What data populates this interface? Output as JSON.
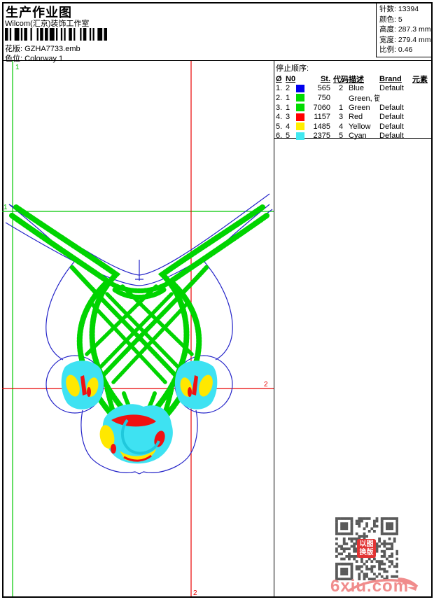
{
  "header": {
    "title": "生产作业图",
    "studio": "Wilcom(汇京)装饰工作室",
    "pattern_label": "花版:",
    "pattern_value": "GZHA7733.emb",
    "colorway_label": "色位:",
    "colorway_value": "Colorway 1"
  },
  "stats": {
    "stitches_label": "针数:",
    "stitches": "13394",
    "colors_label": "颜色:",
    "colors": "5",
    "height_label": "高度:",
    "height": "287.3 mm",
    "width_label": "宽度:",
    "width": "279.4 mm",
    "ratio_label": "比例:",
    "ratio": "0.46"
  },
  "stop_sequence": {
    "title": "停止顺序:",
    "columns": {
      "seq": "Ø",
      "needle": "N0",
      "st": "St.",
      "code": "代码",
      "desc": "描述",
      "brand": "Brand",
      "element": "元素"
    },
    "rows": [
      {
        "seq": "1.",
        "needle": "2",
        "color": "#0000ee",
        "st": "565",
        "code": "2",
        "desc": "Blue",
        "brand": "Default",
        "element": ""
      },
      {
        "seq": "2.",
        "needle": "1",
        "color": "#00dc00",
        "st": "750",
        "code": "",
        "desc": "Green, 链目绣,",
        "brand": "",
        "element": ""
      },
      {
        "seq": "3.",
        "needle": "1",
        "color": "#00dc00",
        "st": "7060",
        "code": "1",
        "desc": "Green",
        "brand": "Default",
        "element": ""
      },
      {
        "seq": "4.",
        "needle": "3",
        "color": "#ff0000",
        "st": "1157",
        "code": "3",
        "desc": "Red",
        "brand": "Default",
        "element": ""
      },
      {
        "seq": "5.",
        "needle": "4",
        "color": "#ffee00",
        "st": "1485",
        "code": "4",
        "desc": "Yellow",
        "brand": "Default",
        "element": ""
      },
      {
        "seq": "6.",
        "needle": "5",
        "color": "#40e8f0",
        "st": "2375",
        "code": "5",
        "desc": "Cyan",
        "brand": "Default",
        "element": ""
      }
    ]
  },
  "guides": {
    "green_color": "#00c800",
    "red_color": "#e80000",
    "v1_label": "1",
    "h1_label": "1",
    "v2_label": "2",
    "h2_label": "2"
  },
  "design_colors": {
    "outline_blue": "#2323c8",
    "stitch_green": "#00d400",
    "cyan": "#3ee2f2",
    "yellow": "#ffe800",
    "red": "#f01010"
  },
  "watermark": {
    "site": "6xiu.com",
    "seal_text_line1": "以图",
    "seal_text_line2": "换版"
  }
}
